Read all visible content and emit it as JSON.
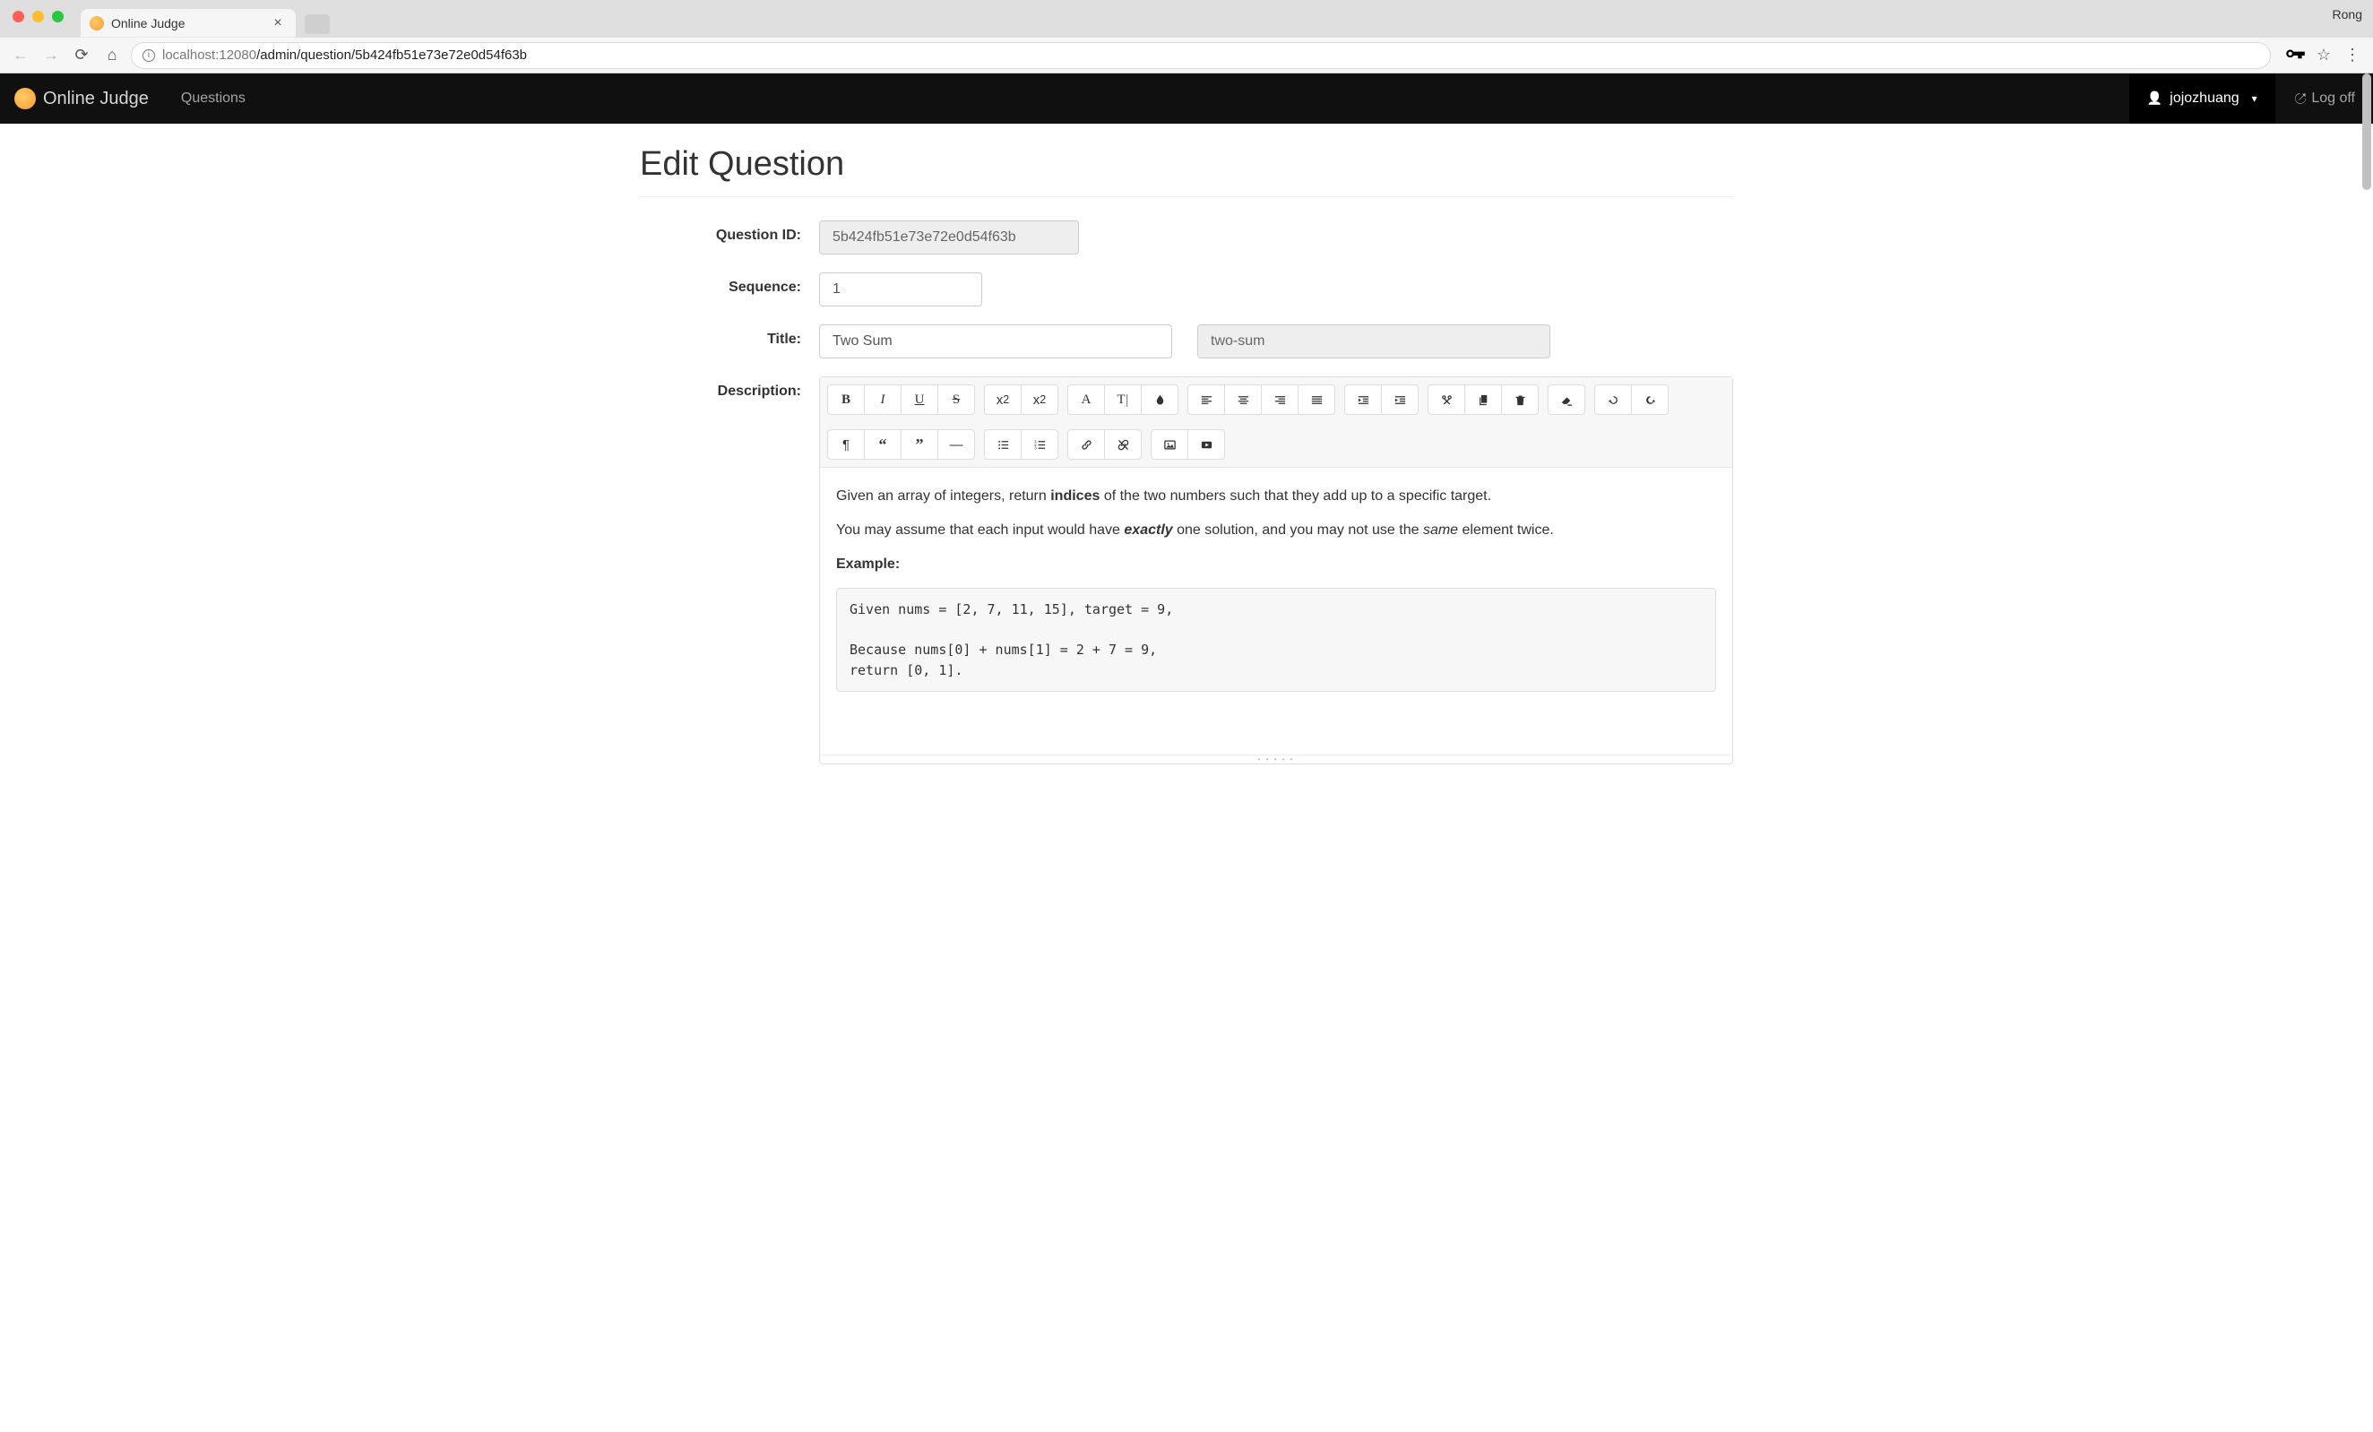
{
  "browser": {
    "profile_name": "Rong",
    "tab_title": "Online Judge",
    "url_host_prefix": "localhost",
    "url_port": ":12080",
    "url_path": "/admin/question/5b424fb51e73e72e0d54f63b"
  },
  "navbar": {
    "brand": "Online Judge",
    "link_questions": "Questions",
    "username": "jojozhuang",
    "logoff": "Log off"
  },
  "page": {
    "title": "Edit Question",
    "labels": {
      "question_id": "Question ID:",
      "sequence": "Sequence:",
      "title": "Title:",
      "description": "Description:"
    },
    "fields": {
      "question_id": "5b424fb51e73e72e0d54f63b",
      "sequence": "1",
      "title": "Two Sum",
      "slug": "two-sum"
    },
    "editor_toolbar": {
      "bold": "B",
      "italic": "I",
      "underline": "U",
      "strike": "S",
      "superscript": "x²",
      "subscript": "x₂",
      "font_size": "A",
      "font_color": "T",
      "font_bg": "●",
      "para": "¶",
      "blockquote_open": "“",
      "blockquote_close": "”",
      "hr": "—"
    },
    "editor_content": {
      "p1_prefix": "Given an array of integers, return ",
      "p1_bold": "indices",
      "p1_suffix": " of the two numbers such that they add up to a specific target.",
      "p2_prefix": "You may assume that each input would have ",
      "p2_italic1": "exactly",
      "p2_mid": " one solution, and you may not use the ",
      "p2_italic2": "same",
      "p2_suffix": " element twice.",
      "example_label": "Example:",
      "code": "Given nums = [2, 7, 11, 15], target = 9,\n\nBecause nums[0] + nums[1] = 2 + 7 = 9,\nreturn [0, 1]."
    }
  }
}
